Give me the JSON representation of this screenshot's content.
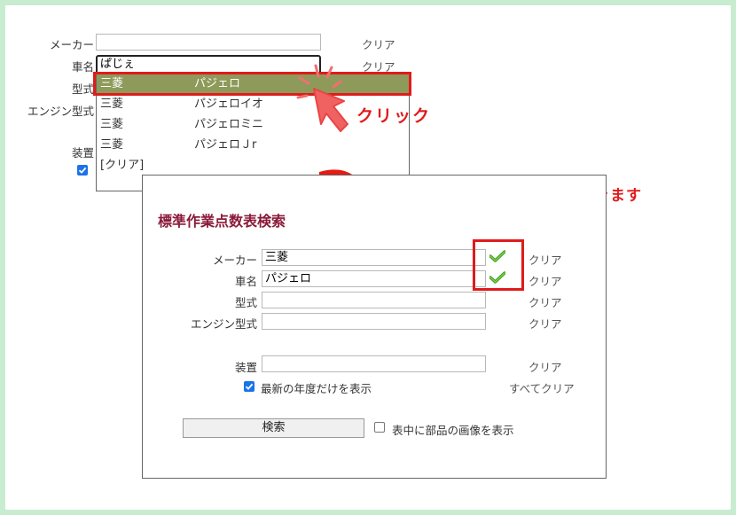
{
  "top_form": {
    "maker_label": "メーカー",
    "car_label": "車名",
    "car_value": "ぱじぇ",
    "model_label": "型式",
    "engine_label": "エンジン型式",
    "equip_label": "装置",
    "clear_label": "クリア"
  },
  "dropdown": {
    "items": [
      {
        "maker": "三菱",
        "car": "パジェロ"
      },
      {
        "maker": "三菱",
        "car": "パジェロイオ"
      },
      {
        "maker": "三菱",
        "car": "パジェロミニ"
      },
      {
        "maker": "三菱",
        "car": "パジェロＪr"
      }
    ],
    "clear_item": "[クリア]",
    "selected_index": 0
  },
  "annotations": {
    "click_text": "クリック",
    "check_text": "チェックマークが付きます",
    "accent_color": "#e01b1b"
  },
  "panel": {
    "title": "標準作業点数表検索",
    "maker_label": "メーカー",
    "maker_value": "三菱",
    "car_label": "車名",
    "car_value": "パジェロ",
    "model_label": "型式",
    "engine_label": "エンジン型式",
    "equip_label": "装置",
    "clear_label": "クリア",
    "latest_year_label": "最新の年度だけを表示",
    "latest_year_checked": true,
    "clear_all_label": "すべてクリア",
    "search_button": "検索",
    "show_images_label": "表中に部品の画像を表示",
    "show_images_checked": false
  }
}
